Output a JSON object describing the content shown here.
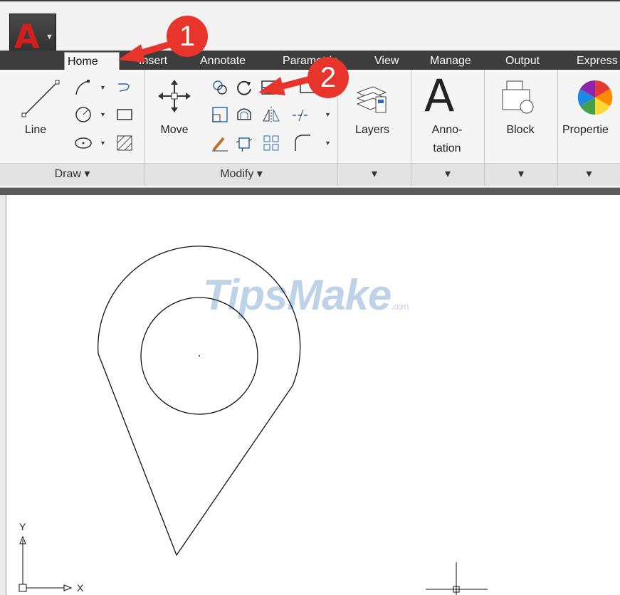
{
  "app": {
    "logo_letter": "A",
    "accent": "#d41e1e"
  },
  "tabs": [
    {
      "label": "Home",
      "active": true
    },
    {
      "label": "Insert"
    },
    {
      "label": "Annotate"
    },
    {
      "label": "Parametric"
    },
    {
      "label": "View"
    },
    {
      "label": "Manage"
    },
    {
      "label": "Output"
    },
    {
      "label": "Express"
    }
  ],
  "ribbon": {
    "draw": {
      "line_label": "Line",
      "panel_title": "Draw ▾"
    },
    "modify": {
      "move_label": "Move",
      "panel_title": "Modify ▾"
    },
    "layers": {
      "label": "Layers"
    },
    "annotation": {
      "glyph": "A",
      "label_line1": "Anno-",
      "label_line2": "tation"
    },
    "block": {
      "label": "Block"
    },
    "properties": {
      "label": "Propertie"
    }
  },
  "callouts": [
    "1",
    "2"
  ],
  "watermark": {
    "main": "TipsMake",
    "suffix": ".com"
  },
  "ucs": {
    "x_label": "X",
    "y_label": "Y"
  }
}
